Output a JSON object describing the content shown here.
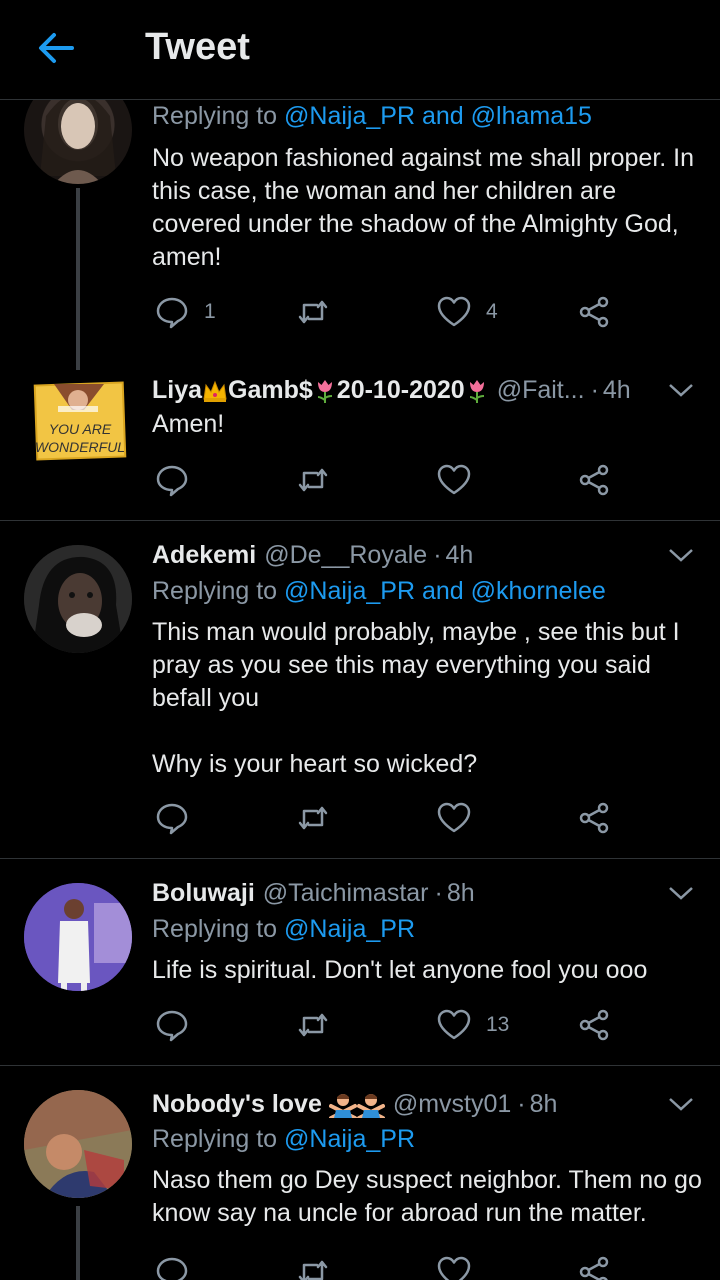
{
  "header": {
    "title": "Tweet"
  },
  "tweets": [
    {
      "reply_prefix": "Replying to",
      "mention1": "@Naija_PR",
      "and": "and",
      "mention2": "@lhama15",
      "text": "No weapon fashioned against me shall proper. In this case, the woman and her children are covered under the shadow of the Almighty God, amen!",
      "replies": "1",
      "likes": "4"
    },
    {
      "name_a": "Liya",
      "name_b": "Gamb$",
      "name_c": "20-10-2020",
      "handle": "@Fait...",
      "dot": "·",
      "time": "4h",
      "text": "Amen!",
      "avatar_text": "YOU ARE WONDERFUL"
    },
    {
      "name": "Adekemi",
      "handle": "@De__Royale",
      "dot": "·",
      "time": "4h",
      "reply_prefix": "Replying to",
      "mention1": "@Naija_PR",
      "and": "and",
      "mention2": "@khornelee",
      "text": "This man would probably, maybe , see this but I pray as you see this may everything you said befall you\n\nWhy is your heart so wicked?"
    },
    {
      "name": "Boluwaji",
      "handle": "@Taichimastar",
      "dot": "·",
      "time": "8h",
      "reply_prefix": "Replying to",
      "mention1": "@Naija_PR",
      "text": "Life is spiritual. Don't let anyone fool you ooo",
      "likes": "13"
    },
    {
      "name": "Nobody's love",
      "handle": "@mvsty01",
      "dot": "·",
      "time": "8h",
      "reply_prefix": "Replying to",
      "mention1": "@Naija_PR",
      "text": "Naso them go Dey suspect neighbor. Them no go know say na uncle for abroad run the matter."
    }
  ],
  "colors": {
    "accent": "#1d9bf0",
    "muted": "#8b98a5",
    "background": "#000000",
    "divider": "#2f3336"
  },
  "icons": [
    "back-arrow-icon",
    "reply-icon",
    "retweet-icon",
    "like-icon",
    "share-icon",
    "chevron-down-icon",
    "crown-emoji-icon",
    "tulip-emoji-icon",
    "person-gesturing-no-emoji-icon"
  ]
}
